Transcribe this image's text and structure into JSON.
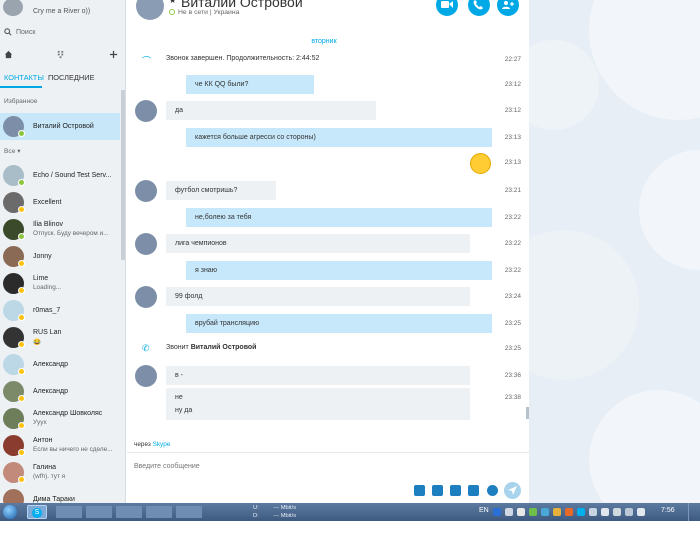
{
  "sidebar": {
    "me_status": "Cry me a River o))",
    "search_placeholder": "Поиск",
    "tabs": [
      "КОНТАКТЫ",
      "ПОСЛЕДНИЕ"
    ],
    "favorites_label": "Избранное",
    "all_label": "Все ▾",
    "favorites": [
      {
        "name": "Виталий Островой",
        "sub": "",
        "avatar_color": "#7d8fa8",
        "status_color": "#8cc63f"
      }
    ],
    "contacts": [
      {
        "name": "Echo / Sound Test Serv...",
        "sub": "",
        "avatar_color": "#a9bdc8",
        "status_color": "#8cc63f"
      },
      {
        "name": "Excellent",
        "sub": "",
        "avatar_color": "#6b6b6b",
        "status_color": "#ffc20e"
      },
      {
        "name": "Ilia Blinov",
        "sub": "Отпуск. Буду вечером и...",
        "avatar_color": "#3a4a2a",
        "status_color": "#8cc63f"
      },
      {
        "name": "Jonny",
        "sub": "",
        "avatar_color": "#8a6a55",
        "status_color": "#ffc20e"
      },
      {
        "name": "Lime",
        "sub": "Loading...",
        "avatar_color": "#2b2b2b",
        "status_color": "#ffc20e"
      },
      {
        "name": "r0mas_7",
        "sub": "",
        "avatar_color": "#bcd7e6",
        "status_color": "#ffc20e"
      },
      {
        "name": "RUS Lan",
        "sub": "😂",
        "avatar_color": "#333333",
        "status_color": "#ffc20e"
      },
      {
        "name": "Александр",
        "sub": "",
        "avatar_color": "#bcd7e6",
        "status_color": "#ffc20e"
      },
      {
        "name": "Александр",
        "sub": "",
        "avatar_color": "#7c8a6a",
        "status_color": "#ffc20e"
      },
      {
        "name": "Александр Шовколяс",
        "sub": "Ууух",
        "avatar_color": "#6e7d5a",
        "status_color": "#ffc20e"
      },
      {
        "name": "Антон",
        "sub": "Если вы ничего не сделе...",
        "avatar_color": "#8a3d2e",
        "status_color": "#ffc20e"
      },
      {
        "name": "Галина",
        "sub": "(wfh). тут я",
        "avatar_color": "#c28a7a",
        "status_color": "#ffc20e"
      },
      {
        "name": "Дима Тараки",
        "sub": "",
        "avatar_color": "#a0705a",
        "status_color": "#ffc20e"
      }
    ]
  },
  "conversation": {
    "title": "Виталий Островой",
    "presence": "Не в сети | Украина",
    "day": "вторник",
    "messages": [
      {
        "kind": "system",
        "icon": "call-ended-icon",
        "text": "Звонок завершен. Продолжительность: 2:44:52",
        "bold": "",
        "time": "22:27"
      },
      {
        "kind": "out",
        "text": "че КК QQ были?",
        "time": "23:12"
      },
      {
        "kind": "in",
        "text": "да",
        "time": "23:12"
      },
      {
        "kind": "out",
        "text": "кажется больше агресси со стороны)",
        "time": "23:13"
      },
      {
        "kind": "emoticon",
        "text": "",
        "time": "23:13"
      },
      {
        "kind": "in",
        "text": "футбол смотришь?",
        "time": "23:21"
      },
      {
        "kind": "out",
        "text": "не,болею за тебя",
        "time": "23:22"
      },
      {
        "kind": "in",
        "text": "лига чемпионов",
        "time": "23:22"
      },
      {
        "kind": "out",
        "text": "я знаю",
        "time": "23:22"
      },
      {
        "kind": "in",
        "text": "99 фолд",
        "time": "23:24"
      },
      {
        "kind": "out",
        "text": "врубай трансляцию",
        "time": "23:25"
      },
      {
        "kind": "system",
        "icon": "incoming-call-icon",
        "text": "Звонит ",
        "bold": "Виталий Островой",
        "time": "23:25"
      },
      {
        "kind": "in",
        "text": "в -",
        "time": "23:36"
      },
      {
        "kind": "in2",
        "text": "не",
        "text2": "ну да",
        "time": "23:38"
      }
    ],
    "via_prefix": "через",
    "via_link": "Skype",
    "input_placeholder": "Введите сообщение"
  },
  "taskbar": {
    "net_u_label": "U:",
    "net_d_label": "D:",
    "net_u_value": "--- Mbit/s",
    "net_d_value": "--- Mbit/s",
    "lang": "EN",
    "clock": "7:56"
  },
  "colors": {
    "accent": "#00a9e6",
    "bubble_out": "#c6e8fa",
    "bubble_in": "#eef1f4",
    "online": "#8cc63f",
    "away": "#ffc20e"
  }
}
